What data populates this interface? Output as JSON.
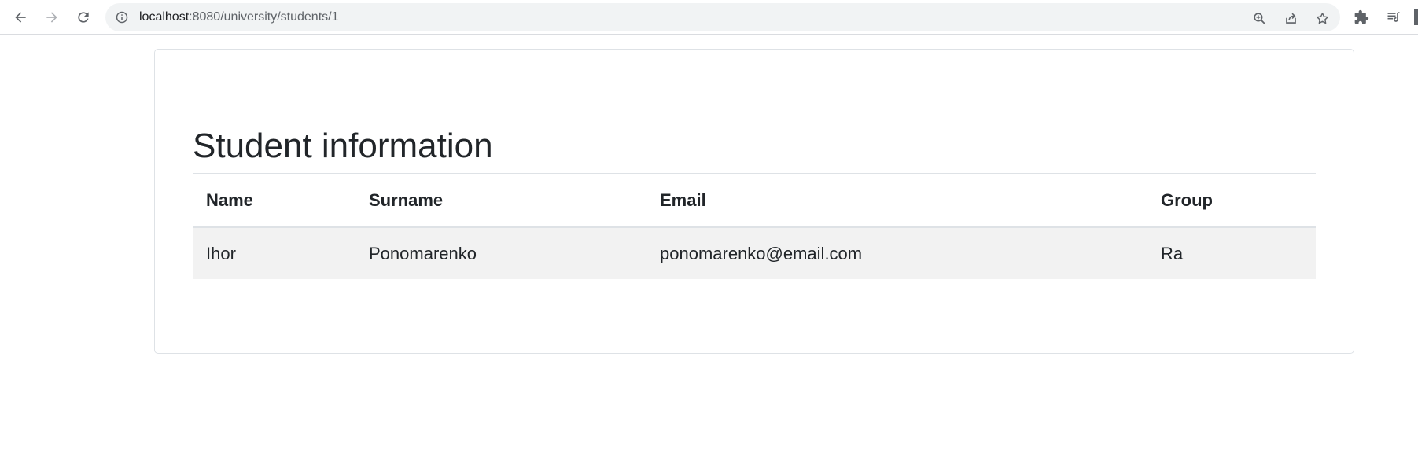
{
  "browser": {
    "url_host": "localhost",
    "url_rest": ":8080/university/students/1"
  },
  "page": {
    "title": "Student information"
  },
  "table": {
    "headers": [
      "Name",
      "Surname",
      "Email",
      "Group"
    ],
    "rows": [
      [
        "Ihor",
        "Ponomarenko",
        "ponomarenko@email.com",
        "Ra"
      ]
    ]
  },
  "icons": {
    "back": "arrow-left-icon",
    "forward": "arrow-right-icon",
    "reload": "reload-icon",
    "site_info": "info-icon",
    "zoom": "zoom-in-icon",
    "share": "share-icon",
    "bookmark": "star-icon",
    "extensions": "puzzle-icon",
    "reading_list": "reading-list-icon"
  },
  "colors": {
    "text": "#212529",
    "toolbar_icon": "#5f6368",
    "omnibox_bg": "#f1f3f4",
    "row_bg": "#f2f2f2",
    "border": "#dee2e6"
  }
}
